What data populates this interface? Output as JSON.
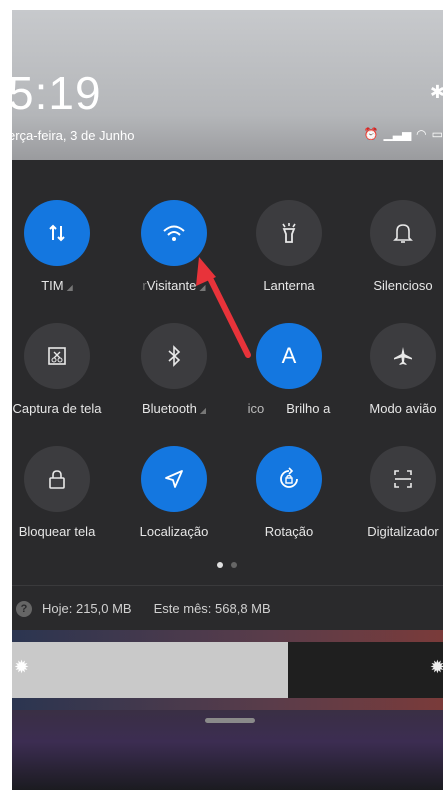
{
  "header": {
    "time": "5:19",
    "date": "erça-feira, 3 de Junho",
    "status_icons": [
      "alarm-icon",
      "signal-icon",
      "wifi-icon",
      "battery-icon"
    ]
  },
  "tiles": [
    {
      "label": "TIM",
      "icon": "mobile-data-icon",
      "active": true,
      "suffix": "◢"
    },
    {
      "label": "Visitante",
      "prefix": "r",
      "icon": "wifi-icon",
      "active": true,
      "suffix": "◢"
    },
    {
      "label": "Lanterna",
      "icon": "flashlight-icon",
      "active": false
    },
    {
      "label": "Silencioso",
      "icon": "bell-icon",
      "active": false
    },
    {
      "label": "Captura de tela",
      "icon": "screenshot-icon",
      "active": false
    },
    {
      "label": "Bluetooth",
      "icon": "bluetooth-icon",
      "active": false,
      "suffix": "◢"
    },
    {
      "label": "Brilho a",
      "prefix": "ico",
      "icon": "auto-brightness-icon",
      "active": true,
      "glyph": "A"
    },
    {
      "label": "Modo avião",
      "icon": "airplane-icon",
      "active": false
    },
    {
      "label": "Bloquear tela",
      "icon": "lock-icon",
      "active": false
    },
    {
      "label": "Localização",
      "icon": "location-icon",
      "active": true
    },
    {
      "label": "Rotação",
      "icon": "rotation-lock-icon",
      "active": true
    },
    {
      "label": "Digitalizador",
      "icon": "scanner-icon",
      "active": false
    }
  ],
  "pager": {
    "pages": 2,
    "current": 1
  },
  "data_usage": {
    "today": "Hoje: 215,0 MB",
    "month": "Este mês: 568,8 MB"
  },
  "brightness": {
    "level": 0.64
  },
  "colors": {
    "accent": "#1477e0",
    "annotation_arrow": "#e8333a"
  }
}
